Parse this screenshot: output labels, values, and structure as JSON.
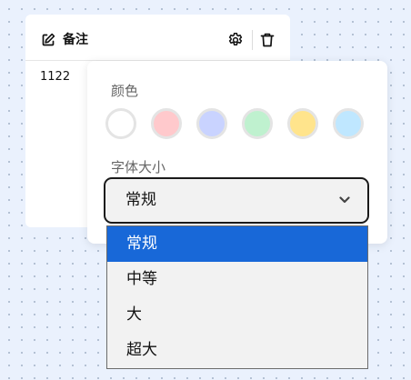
{
  "note": {
    "title": "备注",
    "content": "1122",
    "icons": {
      "note": "note-edit-icon",
      "settings": "gear-icon",
      "delete": "trash-icon"
    }
  },
  "popover": {
    "color_label": "颜色",
    "colors": [
      "#ffffff",
      "#ffc9cc",
      "#c9d3ff",
      "#bff1cf",
      "#ffe48c",
      "#bfe7ff"
    ],
    "size_label": "字体大小",
    "selected_value": "常规",
    "chevron_icon": "chevron-down-icon"
  },
  "dropdown": {
    "options": [
      "常规",
      "中等",
      "大",
      "超大"
    ],
    "selected_index": 0,
    "highlight_color": "#1868d8"
  }
}
